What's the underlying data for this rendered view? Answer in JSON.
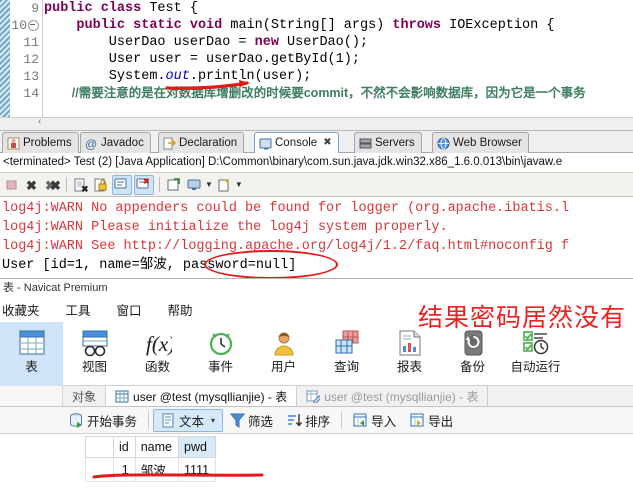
{
  "editor": {
    "lines": [
      {
        "num": "9",
        "fold": false,
        "segments": [
          {
            "t": "kw",
            "v": "public"
          },
          {
            "t": "p",
            "v": " "
          },
          {
            "t": "kw",
            "v": "class"
          },
          {
            "t": "p",
            "v": " Test {"
          }
        ]
      },
      {
        "num": "10",
        "fold": true,
        "segments": [
          {
            "t": "p",
            "v": "    "
          },
          {
            "t": "kw",
            "v": "public"
          },
          {
            "t": "p",
            "v": " "
          },
          {
            "t": "kw",
            "v": "static"
          },
          {
            "t": "p",
            "v": " "
          },
          {
            "t": "kw",
            "v": "void"
          },
          {
            "t": "p",
            "v": " main(String[] args) "
          },
          {
            "t": "kw",
            "v": "throws"
          },
          {
            "t": "p",
            "v": " IOException {"
          }
        ]
      },
      {
        "num": "11",
        "fold": false,
        "segments": [
          {
            "t": "p",
            "v": "        UserDao userDao = "
          },
          {
            "t": "kw",
            "v": "new"
          },
          {
            "t": "p",
            "v": " UserDao();"
          }
        ]
      },
      {
        "num": "12",
        "fold": false,
        "segments": [
          {
            "t": "p",
            "v": "        User user = userDao.getById(1);"
          }
        ]
      },
      {
        "num": "13",
        "fold": false,
        "segments": [
          {
            "t": "p",
            "v": "        System."
          },
          {
            "t": "it",
            "v": "out"
          },
          {
            "t": "p",
            "v": ".println(user);"
          }
        ]
      },
      {
        "num": "14",
        "fold": false,
        "segments": [
          {
            "t": "cmt",
            "v": "        //需要注意的是在对数据库增删改的时候要commit，不然不会影响数据库，因为它是一个事务"
          }
        ]
      }
    ]
  },
  "view_tabs": [
    {
      "label": "Problems",
      "icon": "problems-icon",
      "active": false,
      "closable": false
    },
    {
      "label": "Javadoc",
      "icon": "javadoc-icon",
      "active": false,
      "closable": false
    },
    {
      "label": "Declaration",
      "icon": "declaration-icon",
      "active": false,
      "closable": false
    },
    {
      "label": "Console",
      "icon": "console-icon",
      "active": true,
      "closable": true
    },
    {
      "label": "Servers",
      "icon": "servers-icon",
      "active": false,
      "closable": false
    },
    {
      "label": "Web Browser",
      "icon": "web-browser-icon",
      "active": false,
      "closable": false
    }
  ],
  "console": {
    "launch_line": "<terminated> Test (2) [Java Application] D:\\Common\\binary\\com.sun.java.jdk.win32.x86_1.6.0.013\\bin\\javaw.e",
    "toolbar": [
      {
        "name": "terminate-icon",
        "enabled": false,
        "selected": false
      },
      {
        "name": "remove-launch-icon",
        "enabled": true,
        "selected": false
      },
      {
        "name": "remove-all-terminated-icon",
        "enabled": true,
        "selected": false
      },
      {
        "name": "clear-console-icon",
        "enabled": true,
        "selected": false
      },
      {
        "name": "scroll-lock-icon",
        "enabled": true,
        "selected": false
      },
      {
        "name": "show-console-on-output-icon",
        "enabled": true,
        "selected": true
      },
      {
        "name": "show-console-on-error-icon",
        "enabled": true,
        "selected": true
      },
      {
        "name": "pin-console-icon",
        "enabled": true,
        "selected": false
      },
      {
        "name": "display-selected-console-icon",
        "enabled": true,
        "selected": false
      },
      {
        "name": "open-console-icon",
        "enabled": true,
        "selected": false
      }
    ],
    "output": [
      {
        "text": "log4j:WARN No appenders could be found for logger (org.apache.ibatis.l",
        "color": "red"
      },
      {
        "text": "log4j:WARN Please initialize the log4j system properly.",
        "color": "red"
      },
      {
        "text": "log4j:WARN See http://logging.apache.org/log4j/1.2/faq.html#noconfig f",
        "color": "red"
      },
      {
        "text": "User [id=1, name=邹波, password=null]",
        "color": "black"
      }
    ]
  },
  "navicat": {
    "title": "表 - Navicat Premium",
    "menu": [
      "收藏夹",
      "工具",
      "窗口",
      "帮助"
    ],
    "annotation": "结果密码居然没有",
    "annotation_color": "#ee2222",
    "ribbon": [
      {
        "label": "表",
        "icon": "table-icon",
        "selected": true
      },
      {
        "label": "视图",
        "icon": "view-icon",
        "selected": false
      },
      {
        "label": "函数",
        "icon": "function-icon",
        "selected": false
      },
      {
        "label": "事件",
        "icon": "event-icon",
        "selected": false
      },
      {
        "label": "用户",
        "icon": "user-icon",
        "selected": false
      },
      {
        "label": "查询",
        "icon": "query-icon",
        "selected": false
      },
      {
        "label": "报表",
        "icon": "report-icon",
        "selected": false
      },
      {
        "label": "备份",
        "icon": "backup-icon",
        "selected": false
      },
      {
        "label": "自动运行",
        "icon": "autorun-icon",
        "selected": false
      }
    ],
    "object_tabs": [
      {
        "label": "对象",
        "icon": "none",
        "state": "plain"
      },
      {
        "label": "user @test (mysqllianjie) - 表",
        "icon": "table-tab-icon",
        "state": "active"
      },
      {
        "label": "user @test (mysqllianjie) - 表",
        "icon": "table-design-icon",
        "state": "dim"
      }
    ],
    "grid_toolbar": [
      {
        "label": "开始事务",
        "icon": "begin-transaction-icon",
        "boxed": false,
        "dropdown": false
      },
      {
        "label": "文本",
        "icon": "text-icon",
        "boxed": true,
        "dropdown": true
      },
      {
        "label": "筛选",
        "icon": "filter-icon",
        "boxed": false,
        "dropdown": false
      },
      {
        "label": "排序",
        "icon": "sort-icon",
        "boxed": false,
        "dropdown": false
      },
      {
        "label": "导入",
        "icon": "import-icon",
        "boxed": false,
        "dropdown": false
      },
      {
        "label": "导出",
        "icon": "export-icon",
        "boxed": false,
        "dropdown": false
      }
    ],
    "grid": {
      "columns": [
        {
          "name": "id",
          "highlight": false
        },
        {
          "name": "name",
          "highlight": false
        },
        {
          "name": "pwd",
          "highlight": true
        }
      ],
      "rows": [
        {
          "id": "1",
          "name": "邹波",
          "pwd": "1111"
        }
      ]
    }
  }
}
